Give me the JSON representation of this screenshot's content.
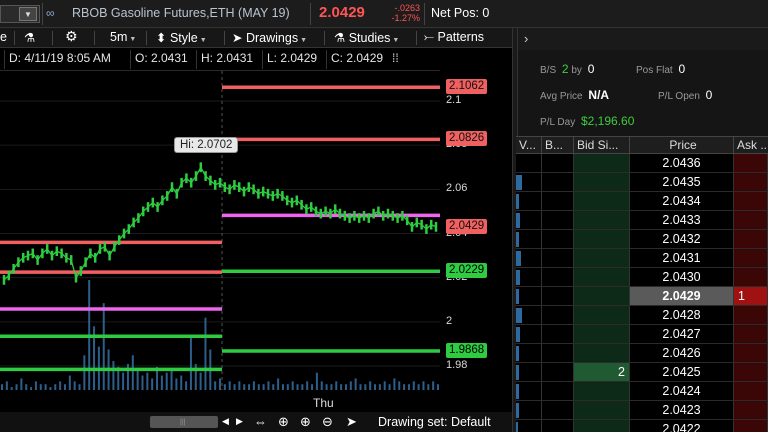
{
  "header": {
    "symbol_dropdown": "▼",
    "link_icon": "link-icon",
    "instrument": "RBOB Gasoline Futures,ETH (MAY 19)",
    "last_price": "2.0429",
    "net_change": "-.0263",
    "pct_change": "-1.27%",
    "net_pos": "Net Pos: 0",
    "colors": {
      "down": "#ff5555",
      "up": "#3fcc3f"
    }
  },
  "toolbar": {
    "timeframe": "5m",
    "style": "Style",
    "drawings": "Drawings",
    "studies": "Studies",
    "patterns": "Patterns",
    "icons": [
      "flask-icon",
      "gear-icon",
      "style-icon",
      "cursor-icon",
      "studies-flask-icon",
      "patterns-icon"
    ]
  },
  "ohlc": {
    "date": "D: 4/11/19 8:05 AM",
    "open": "O: 2.0431",
    "high": "H: 2.0431",
    "low": "L: 2.0429",
    "close": "C: 2.0429",
    "more": "⁞⁞"
  },
  "chart": {
    "hi_label": "Hi: 2.0702",
    "axis_ticks": [
      "2.1",
      "2.08",
      "2.06",
      "2.04",
      "2.02",
      "2",
      "1.98"
    ],
    "price_tags": [
      {
        "label": "2.1062",
        "kind": "red"
      },
      {
        "label": "2.0826",
        "kind": "red"
      },
      {
        "label": "2.0429",
        "kind": "red"
      },
      {
        "label": "2.0229",
        "kind": "green"
      },
      {
        "label": "1.9868",
        "kind": "green"
      }
    ],
    "time_label": "Thu",
    "line_colors": {
      "red": "#f06060",
      "green": "#2ecc40",
      "magenta": "#ee66ee",
      "candle": "#2ecc40"
    }
  },
  "chart_data": {
    "type": "line",
    "title": "",
    "xlabel": "",
    "ylabel": "",
    "ylim": [
      1.97,
      2.115
    ],
    "series": [
      {
        "values": [
          2.019,
          2.021,
          2.024,
          2.027,
          2.029,
          2.03,
          2.031,
          2.028,
          2.031,
          2.033,
          2.03,
          2.032,
          2.031,
          2.029,
          2.028,
          2.02,
          2.023,
          2.027,
          2.031,
          2.029,
          2.033,
          2.034,
          2.03,
          2.034,
          2.037,
          2.04,
          2.042,
          2.045,
          2.047,
          2.05,
          2.052,
          2.054,
          2.052,
          2.055,
          2.057,
          2.061,
          2.058,
          2.063,
          2.065,
          2.063,
          2.066,
          2.07,
          2.066,
          2.064,
          2.062,
          2.063,
          2.061,
          2.06,
          2.062,
          2.061,
          2.059,
          2.061,
          2.06,
          2.058,
          2.059,
          2.058,
          2.057,
          2.058,
          2.057,
          2.055,
          2.054,
          2.055,
          2.053,
          2.051,
          2.052,
          2.05,
          2.049,
          2.05,
          2.049,
          2.051,
          2.049,
          2.048,
          2.047,
          2.048,
          2.047,
          2.048,
          2.047,
          2.049,
          2.05,
          2.048,
          2.049,
          2.048,
          2.047,
          2.048,
          2.046,
          2.043,
          2.045,
          2.044,
          2.042,
          2.044,
          2.043
        ]
      }
    ],
    "volume": [
      2,
      3,
      1,
      2,
      4,
      2,
      1,
      3,
      2,
      2,
      1,
      2,
      3,
      2,
      5,
      3,
      2,
      12,
      38,
      22,
      15,
      30,
      14,
      10,
      8,
      6,
      9,
      12,
      7,
      5,
      6,
      4,
      8,
      5,
      6,
      7,
      4,
      5,
      3,
      18,
      9,
      6,
      25,
      14,
      3,
      4,
      2,
      3,
      2,
      3,
      2,
      2,
      3,
      2,
      2,
      3,
      2,
      4,
      2,
      2,
      3,
      2,
      2,
      3,
      2,
      6,
      3,
      2,
      2,
      3,
      2,
      2,
      3,
      4,
      2,
      2,
      3,
      2,
      2,
      3,
      2,
      4,
      3,
      2,
      2,
      3,
      2,
      3,
      2,
      3,
      2
    ],
    "levels": [
      {
        "value": 2.1062,
        "color": "red",
        "from": "mid"
      },
      {
        "value": 2.0826,
        "color": "red",
        "from": "mid"
      },
      {
        "value": 2.0482,
        "color": "magenta",
        "from": "mid"
      },
      {
        "value": 2.0229,
        "color": "green",
        "from": "mid"
      },
      {
        "value": 1.9868,
        "color": "green",
        "from": "mid"
      },
      {
        "value": 2.036,
        "color": "red",
        "from": "left"
      },
      {
        "value": 2.0225,
        "color": "red",
        "from": "left"
      },
      {
        "value": 2.0058,
        "color": "magenta",
        "from": "left"
      },
      {
        "value": 1.9935,
        "color": "green",
        "from": "left"
      },
      {
        "value": 1.9785,
        "color": "green",
        "from": "left"
      }
    ]
  },
  "bottom": {
    "drawing_set": "Drawing set: Default",
    "icons": [
      "pan-arrows-icon",
      "crosshair-icon",
      "zoom-in-icon",
      "zoom-out-icon",
      "pointer-icon"
    ]
  },
  "panel": {
    "expand_icon": "chevron-right-icon",
    "bs": {
      "label": "B/S",
      "value": "2",
      "by": "by",
      "value2": "0"
    },
    "pos_flat": {
      "label": "Pos Flat",
      "value": "0"
    },
    "avg_price": {
      "label": "Avg Price",
      "value": "N/A"
    },
    "pl_open": {
      "label": "P/L Open",
      "value": "0"
    },
    "pl_day": {
      "label": "P/L Day",
      "value": "$2,196.60"
    }
  },
  "ladder": {
    "columns": [
      "V...",
      "B...",
      "Bid Si...",
      "Price",
      "Ask ..."
    ],
    "rows": [
      {
        "price": "2.0436",
        "vol": 0.0,
        "bid": "",
        "ask": ""
      },
      {
        "price": "2.0435",
        "vol": 0.6,
        "bid": "",
        "ask": ""
      },
      {
        "price": "2.0434",
        "vol": 0.3,
        "bid": "",
        "ask": ""
      },
      {
        "price": "2.0433",
        "vol": 0.4,
        "bid": "",
        "ask": ""
      },
      {
        "price": "2.0432",
        "vol": 0.3,
        "bid": "",
        "ask": ""
      },
      {
        "price": "2.0431",
        "vol": 0.5,
        "bid": "",
        "ask": ""
      },
      {
        "price": "2.0430",
        "vol": 0.4,
        "bid": "",
        "ask": ""
      },
      {
        "price": "2.0429",
        "vol": 0.3,
        "bid": "",
        "ask": "1",
        "current": true
      },
      {
        "price": "2.0428",
        "vol": 0.6,
        "bid": "",
        "ask": ""
      },
      {
        "price": "2.0427",
        "vol": 0.4,
        "bid": "",
        "ask": ""
      },
      {
        "price": "2.0426",
        "vol": 0.3,
        "bid": "",
        "ask": ""
      },
      {
        "price": "2.0425",
        "vol": 0.3,
        "bid": "2",
        "ask": ""
      },
      {
        "price": "2.0424",
        "vol": 0.3,
        "bid": "",
        "ask": ""
      },
      {
        "price": "2.0423",
        "vol": 0.3,
        "bid": "",
        "ask": ""
      },
      {
        "price": "2.0422",
        "vol": 0.2,
        "bid": "",
        "ask": ""
      }
    ]
  }
}
